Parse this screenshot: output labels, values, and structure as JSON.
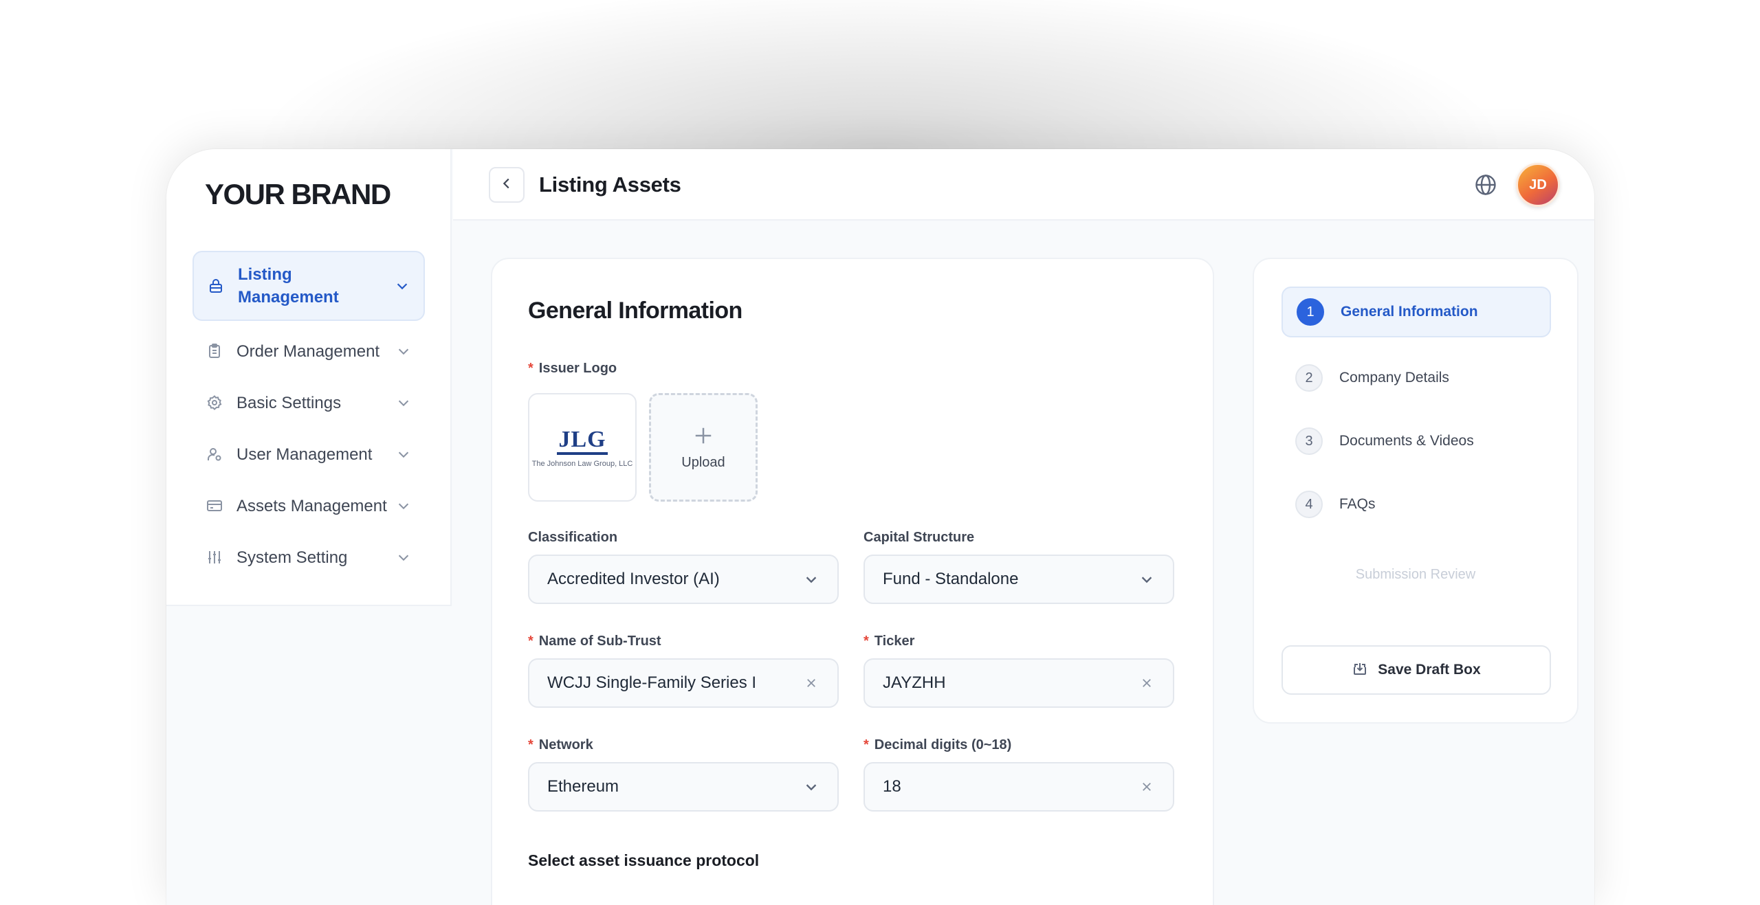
{
  "brand": "YOUR BRAND",
  "sidebar": {
    "items": [
      {
        "label": "Listing Management",
        "icon": "lock-icon"
      },
      {
        "label": "Order Management",
        "icon": "clipboard-icon"
      },
      {
        "label": "Basic Settings",
        "icon": "gear-icon"
      },
      {
        "label": "User Management",
        "icon": "user-icon"
      },
      {
        "label": "Assets Management",
        "icon": "card-icon"
      },
      {
        "label": "System Setting",
        "icon": "sliders-icon"
      }
    ]
  },
  "header": {
    "title": "Listing Assets",
    "avatar_initials": "JD"
  },
  "form": {
    "section_title": "General Information",
    "issuer_logo_label": "Issuer Logo",
    "logo_text": "JLG",
    "logo_subtext": "The Johnson Law Group, LLC",
    "upload_label": "Upload",
    "classification": {
      "label": "Classification",
      "value": "Accredited Investor (AI)"
    },
    "capital_structure": {
      "label": "Capital Structure",
      "value": "Fund - Standalone"
    },
    "sub_trust": {
      "label": "Name of Sub-Trust",
      "value": "WCJJ Single-Family Series I"
    },
    "ticker": {
      "label": "Ticker",
      "value": "JAYZHH"
    },
    "network": {
      "label": "Network",
      "value": "Ethereum"
    },
    "decimal_digits": {
      "label": "Decimal digits (0~18)",
      "value": "18"
    },
    "protocol_heading": "Select asset issuance protocol",
    "required_mark": "*"
  },
  "steps": {
    "items": [
      {
        "num": "1",
        "label": "General Information"
      },
      {
        "num": "2",
        "label": "Company Details"
      },
      {
        "num": "3",
        "label": "Documents & Videos"
      },
      {
        "num": "4",
        "label": "FAQs"
      }
    ],
    "submission_review": "Submission Review",
    "save_draft": "Save Draft Box"
  },
  "colors": {
    "accent": "#2b63dd",
    "required": "#e5483b",
    "brand_logo": "#1f3f86"
  }
}
